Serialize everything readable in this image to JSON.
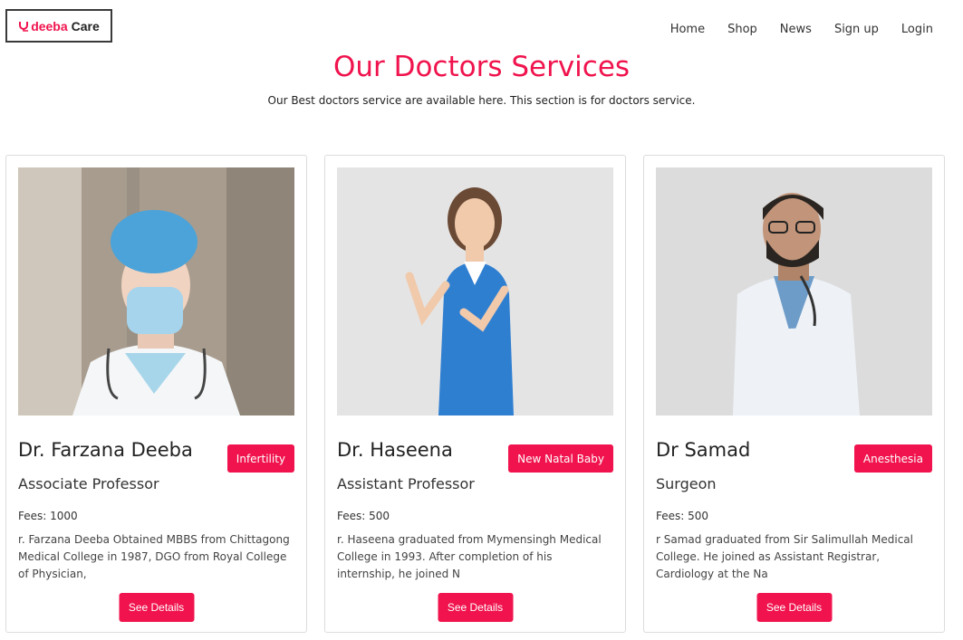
{
  "header": {
    "brand": "deeba",
    "brand_suffix": "Care",
    "nav": [
      "Home",
      "Shop",
      "News",
      "Sign up",
      "Login"
    ]
  },
  "section": {
    "title": "Our Doctors Services",
    "subtitle": "Our Best doctors service are available here. This section is for doctors service."
  },
  "doctors": [
    {
      "name": "Dr. Farzana Deeba",
      "specialty": "Infertility",
      "role": "Associate Professor",
      "fees": "Fees: 1000",
      "description": "r. Farzana Deeba Obtained MBBS from Chittagong Medical College in 1987, DGO from Royal College of Physician,",
      "button": "See Details"
    },
    {
      "name": "Dr. Haseena",
      "specialty": "New Natal Baby",
      "role": "Assistant Professor",
      "fees": "Fees: 500",
      "description": "r. Haseena graduated from Mymensingh Medical College in 1993. After completion of his internship, he joined N",
      "button": "See Details"
    },
    {
      "name": "Dr Samad",
      "specialty": "Anesthesia",
      "role": "Surgeon",
      "fees": "Fees: 500",
      "description": "r Samad graduated from Sir Salimullah Medical College. He joined as Assistant Registrar, Cardiology at the Na",
      "button": "See Details"
    }
  ],
  "colors": {
    "accent": "#f0134d",
    "text": "#222222",
    "border": "#dcdcdc"
  }
}
